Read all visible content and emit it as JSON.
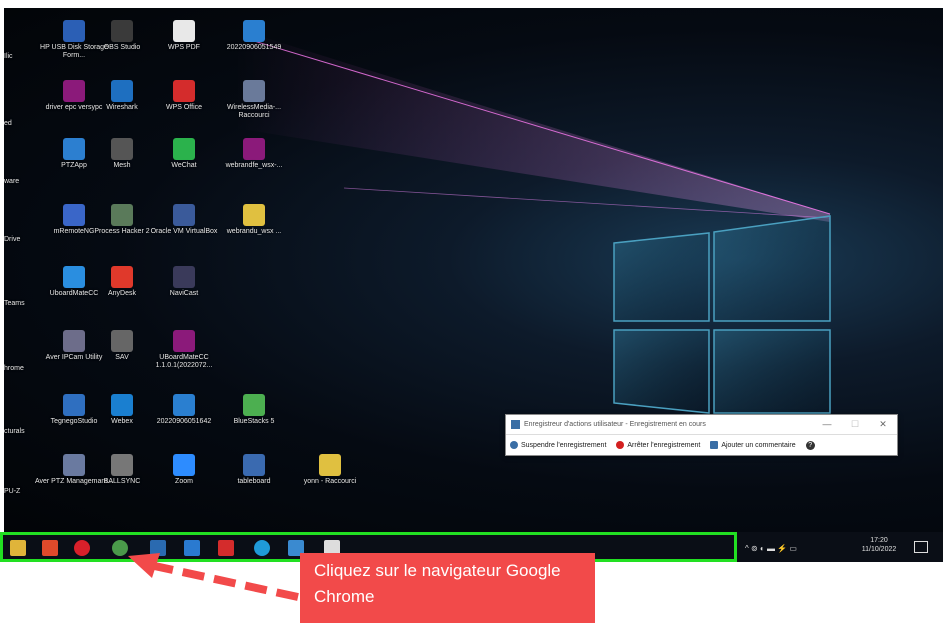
{
  "desktop": {
    "columns": [
      {
        "items": [
          {
            "label": "HP USB Disk Storage Form...",
            "color": "#2b5fb5",
            "icon": "usb-disk-icon"
          },
          {
            "label": "driver epc versypc",
            "color": "#8b1a7a",
            "icon": "winrar-icon"
          },
          {
            "label": "PTZApp",
            "color": "#2c7fd0",
            "icon": "app-icon"
          },
          {
            "label": "mRemoteNG",
            "color": "#3a66c8",
            "icon": "mremoteng-icon"
          },
          {
            "label": "UboardMateCC",
            "color": "#2a8ee0",
            "icon": "uboard-icon"
          },
          {
            "label": "Aver IPCam Utility",
            "color": "#6d6d8a",
            "icon": "ipcam-icon"
          },
          {
            "label": "TegnegoStudio",
            "color": "#2f6fc0",
            "icon": "studio-icon"
          },
          {
            "label": "Aver PTZ Managemant...",
            "color": "#6a7aa0",
            "icon": "ptz-icon"
          }
        ]
      },
      {
        "items": [
          {
            "label": "OBS Studio",
            "color": "#3a3a3a",
            "icon": "obs-icon"
          },
          {
            "label": "Wireshark",
            "color": "#1e6fc0",
            "icon": "wireshark-icon"
          },
          {
            "label": "Mesh",
            "color": "#555",
            "icon": "mesh-icon"
          },
          {
            "label": "Process Hacker 2",
            "color": "#5a7a5a",
            "icon": "process-hacker-icon"
          },
          {
            "label": "AnyDesk",
            "color": "#e0392b",
            "icon": "anydesk-icon"
          },
          {
            "label": "SAV",
            "color": "#666",
            "icon": "sav-icon"
          },
          {
            "label": "Webex",
            "color": "#1a7fd0",
            "icon": "webex-icon"
          },
          {
            "label": "BALLSYNC",
            "color": "#777",
            "icon": "ballsync-icon"
          }
        ]
      },
      {
        "items": [
          {
            "label": "WPS PDF",
            "color": "#e8e8e8",
            "icon": "pdf-icon"
          },
          {
            "label": "WPS Office",
            "color": "#d42c2c",
            "icon": "wps-office-icon"
          },
          {
            "label": "WeChat",
            "color": "#2bb24c",
            "icon": "wechat-icon"
          },
          {
            "label": "Oracle VM VirtualBox",
            "color": "#3a5a9a",
            "icon": "virtualbox-icon"
          },
          {
            "label": "NaviCast",
            "color": "#3a3a5a",
            "icon": "navicast-icon"
          },
          {
            "label": "UBoardMateCC 1.1.0.1(2022072...",
            "color": "#8b1a7a",
            "icon": "winrar-icon"
          },
          {
            "label": "20220906051642",
            "color": "#2a7fd0",
            "icon": "file-icon"
          },
          {
            "label": "Zoom",
            "color": "#2d8cff",
            "icon": "zoom-icon"
          }
        ]
      },
      {
        "items": [
          {
            "label": "20220906051549",
            "color": "#2a7fd0",
            "icon": "file-icon"
          },
          {
            "label": "WirelessMedia-... Raccourci",
            "color": "#6a7a9a",
            "icon": "shortcut-icon"
          },
          {
            "label": "webrandfe_wsx-...",
            "color": "#8b1a7a",
            "icon": "winrar-icon"
          },
          {
            "label": "webrandu_wsx ...",
            "color": "#e0c040",
            "icon": "folder-icon"
          },
          {
            "label": "BlueStacks 5",
            "color": "#4caf50",
            "icon": "bluestacks-icon"
          },
          {
            "label": "tableboard",
            "color": "#3a6ab0",
            "icon": "tableboard-icon"
          }
        ]
      },
      {
        "items": [
          {
            "label": "yonn - Raccourci",
            "color": "#e0c040",
            "icon": "folder-shortcut-icon"
          }
        ]
      }
    ],
    "left_edge_labels": [
      "Ilic",
      "ed",
      "ware",
      "Drive",
      "Teams",
      "hrome",
      "cturals",
      "PU-Z"
    ]
  },
  "recorder": {
    "title": "Enregistreur d'actions utilisateur - Enregistrement en cours",
    "pause": "Suspendre l'enregistrement",
    "stop": "Arrêter l'enregistrement",
    "comment": "Ajouter un commentaire",
    "help": "?",
    "min": "—",
    "max": "☐",
    "close": "✕"
  },
  "taskbar": {
    "icons": [
      {
        "name": "file-explorer-icon",
        "color": "#e0b43a"
      },
      {
        "name": "office-icon",
        "color": "#e04a2b"
      },
      {
        "name": "opera-icon",
        "color": "#d8202a"
      },
      {
        "name": "chrome-icon",
        "color": "#4a9a4a"
      },
      {
        "name": "app-icon",
        "color": "#2a6ab0"
      },
      {
        "name": "app2-icon",
        "color": "#2a7ad0"
      },
      {
        "name": "wps-icon",
        "color": "#d42c2c"
      },
      {
        "name": "edge-icon",
        "color": "#1f9ad8"
      },
      {
        "name": "app3-icon",
        "color": "#3a8ad0"
      },
      {
        "name": "app4-icon",
        "color": "#dddddd"
      }
    ],
    "tray": "^ ⊚ ◐ ▬ ⚡ ▭",
    "time": "17:20",
    "date": "11/10/2022"
  },
  "callout": {
    "text": "Cliquez sur le navigateur Google Chrome"
  },
  "colors": {
    "highlight": "#22e022",
    "callout": "#f24a4a"
  }
}
